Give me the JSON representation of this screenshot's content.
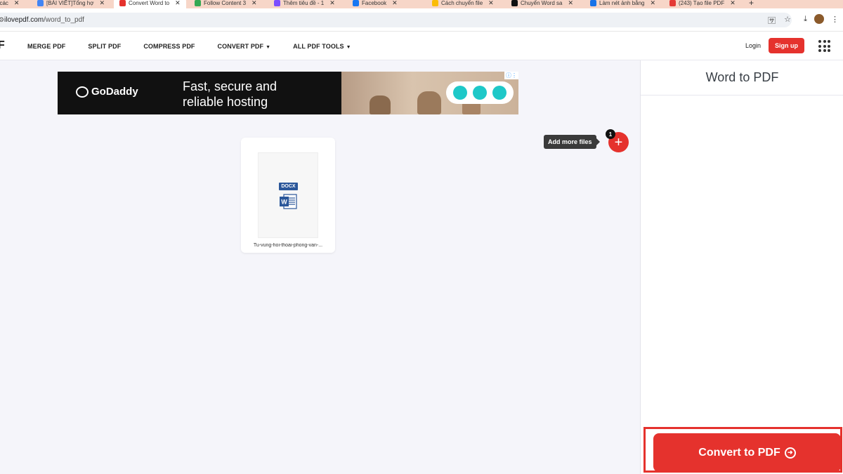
{
  "browser": {
    "tabs": [
      {
        "label": "Các các",
        "fav": "#444"
      },
      {
        "label": "[BÀI VIẾT]Tổng hợ",
        "fav": "#4285f4"
      },
      {
        "label": "Convert Word to",
        "fav": "#e5322d"
      },
      {
        "label": "Follow Content 3",
        "fav": "#34a853"
      },
      {
        "label": "Thêm tiêu đề - 1",
        "fav": "#7c4dff"
      },
      {
        "label": "Facebook",
        "fav": "#1877f2"
      },
      {
        "label": "Cách chuyển file",
        "fav": "#fbbc04"
      },
      {
        "label": "Chuyển Word sa",
        "fav": "#111111"
      },
      {
        "label": "Làm nét ảnh bằng",
        "fav": "#1a73e8"
      },
      {
        "label": "(243) Tạo file PDF",
        "fav": "#e53935"
      }
    ],
    "new_tab": "+",
    "url_host": "ilovepdf.com",
    "url_path": "/word_to_pdf"
  },
  "site": {
    "logo": "F",
    "nav": [
      {
        "label": "MERGE PDF",
        "caret": ""
      },
      {
        "label": "SPLIT PDF",
        "caret": ""
      },
      {
        "label": "COMPRESS PDF",
        "caret": ""
      },
      {
        "label": "CONVERT PDF",
        "caret": "▼"
      },
      {
        "label": "ALL PDF TOOLS",
        "caret": "▼"
      }
    ],
    "login": "Login",
    "signup": "Sign up"
  },
  "ad": {
    "brand": "GoDaddy",
    "line1": "Fast, secure and",
    "line2": "reliable hosting"
  },
  "file": {
    "badge": "DOCX",
    "name": "Tu-vung-hoi-thoai-phong-van-..."
  },
  "add_more": {
    "tooltip": "Add more files",
    "count": "1",
    "plus": "+"
  },
  "sidebar": {
    "title": "Word to PDF",
    "convert_label": "Convert to PDF"
  },
  "colors": {
    "brand_red": "#e5322d",
    "word_blue": "#2b579a"
  }
}
